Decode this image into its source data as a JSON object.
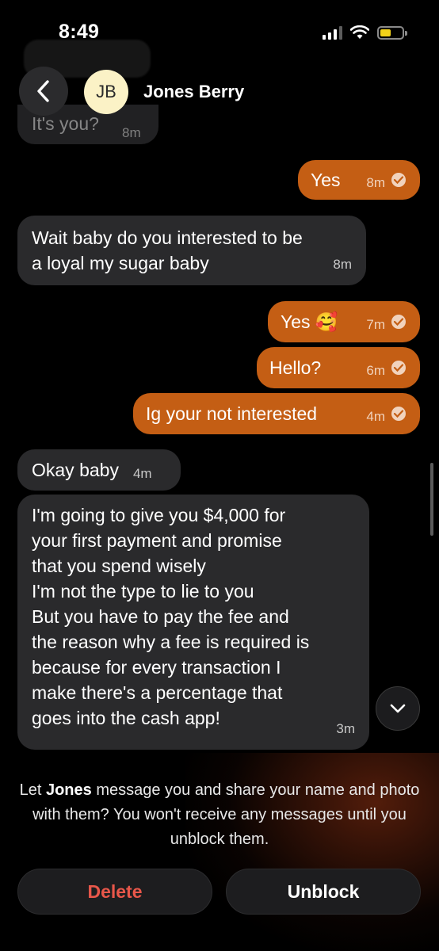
{
  "status_bar": {
    "time": "8:49",
    "battery_color": "#f4d31a"
  },
  "header": {
    "back_icon": "chevron-left-icon",
    "avatar_initials": "JB",
    "contact_name": "Jones Berry"
  },
  "colors": {
    "outgoing_bubble": "#c45e14",
    "incoming_bubble": "#2a2a2c",
    "delete_text": "#e8574a"
  },
  "messages": [
    {
      "direction": "in",
      "text": "It's you?",
      "time": "8m"
    },
    {
      "direction": "out",
      "text": "Yes",
      "time": "8m",
      "read": true
    },
    {
      "direction": "in",
      "lines": [
        "Wait baby do you interested to be",
        "a loyal my sugar baby"
      ],
      "time": "8m"
    },
    {
      "direction": "out",
      "text": "Yes 🥰",
      "time": "7m",
      "read": true
    },
    {
      "direction": "out",
      "text": "Hello?",
      "time": "6m",
      "read": true
    },
    {
      "direction": "out",
      "text": "Ig your not interested",
      "time": "4m",
      "read": true
    },
    {
      "direction": "in",
      "text": "Okay baby",
      "time": "4m"
    },
    {
      "direction": "in",
      "lines": [
        "I'm going to give you $4,000 for",
        "your first payment and promise",
        "that you spend wisely",
        "I'm not the type to lie to you",
        "But you have to pay the fee and",
        "the reason why a fee is required is",
        "because for every transaction I",
        "make there's a percentage that",
        "goes into the cash app!"
      ],
      "time": "3m"
    }
  ],
  "scroll_down_icon": "chevron-down-icon",
  "notice": {
    "prefix": "Let ",
    "name": "Jones",
    "suffix": " message you and share your name and photo with them? You won't receive any messages until you unblock them."
  },
  "actions": {
    "delete_label": "Delete",
    "unblock_label": "Unblock"
  }
}
